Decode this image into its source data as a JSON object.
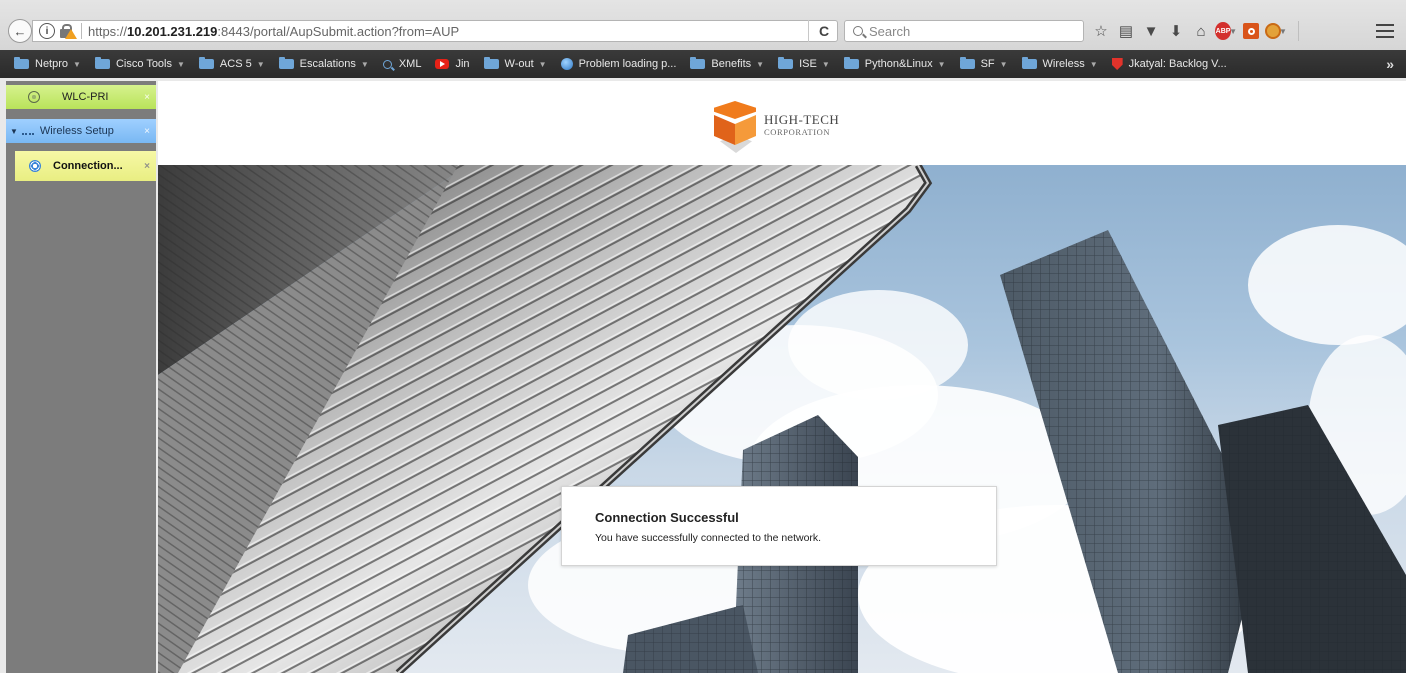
{
  "browser": {
    "url_prefix": "https://",
    "url_host": "10.201.231.219",
    "url_rest": ":8443/portal/AupSubmit.action?from=AUP",
    "reload_glyph": "C",
    "search_placeholder": "Search",
    "toolbar_icons": [
      "star-icon",
      "reading-list-icon",
      "pocket-icon",
      "download-icon",
      "home-icon",
      "adblock-plus-icon",
      "extension-icon",
      "extension-face-icon"
    ],
    "abp_label": "ABP",
    "bookmarks_overflow": "»"
  },
  "bookmarks": [
    {
      "label": "Netpro",
      "icon": "folder-icon",
      "dropdown": true
    },
    {
      "label": "Cisco Tools",
      "icon": "folder-icon",
      "dropdown": true
    },
    {
      "label": "ACS 5",
      "icon": "folder-icon",
      "dropdown": true
    },
    {
      "label": "Escalations",
      "icon": "folder-icon",
      "dropdown": true
    },
    {
      "label": "XML",
      "icon": "search-icon",
      "dropdown": false
    },
    {
      "label": "Jin",
      "icon": "youtube-icon",
      "dropdown": false
    },
    {
      "label": "W-out",
      "icon": "folder-icon",
      "dropdown": true
    },
    {
      "label": "Problem loading p...",
      "icon": "globe-icon",
      "dropdown": false
    },
    {
      "label": "Benefits",
      "icon": "folder-icon",
      "dropdown": true
    },
    {
      "label": "ISE",
      "icon": "folder-icon",
      "dropdown": true
    },
    {
      "label": "Python&Linux",
      "icon": "folder-icon",
      "dropdown": true
    },
    {
      "label": "SF",
      "icon": "folder-icon",
      "dropdown": true
    },
    {
      "label": "Wireless",
      "icon": "folder-icon",
      "dropdown": true
    },
    {
      "label": "Jkatyal: Backlog V...",
      "icon": "shield-icon",
      "dropdown": false
    }
  ],
  "left_panel": {
    "items": [
      {
        "label": "WLC-PRI",
        "close": "×"
      },
      {
        "label": "Wireless Setup",
        "close": "×"
      },
      {
        "label": "Connection...",
        "close": "×"
      }
    ]
  },
  "portal": {
    "logo_line1": "HIGH-TECH",
    "logo_line2": "CORPORATION",
    "message_title": "Connection Successful",
    "message_body": "You have successfully connected to the network."
  },
  "colors": {
    "wlc_tab": "#c3e86f",
    "wireless_setup_tab": "#8cc4fa",
    "connection_tab": "#eef18d",
    "logo_orange": "#f07b1c"
  }
}
